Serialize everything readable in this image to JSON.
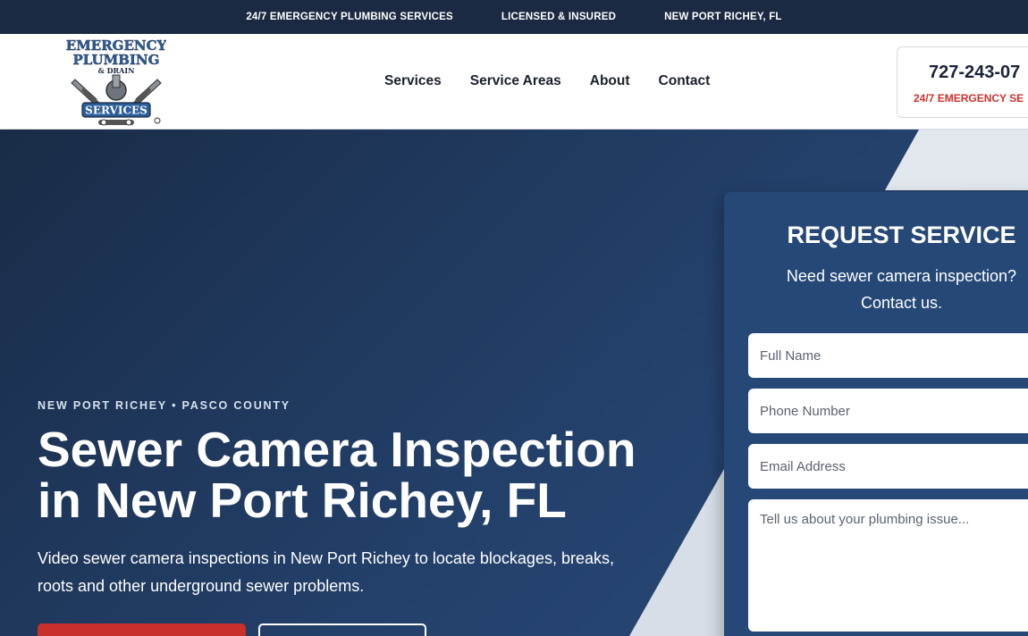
{
  "topbar": {
    "items": [
      "24/7 EMERGENCY PLUMBING SERVICES",
      "LICENSED & INSURED",
      "NEW PORT RICHEY, FL"
    ]
  },
  "header": {
    "logo": {
      "line1": "EMERGENCY",
      "line2": "PLUMBING",
      "line3": "& DRAIN",
      "line4": "SERVICES"
    },
    "nav": [
      "Services",
      "Service Areas",
      "About",
      "Contact"
    ],
    "phone": {
      "number": "727-243-07",
      "subtitle": "24/7 EMERGENCY SE"
    }
  },
  "hero": {
    "eyebrow": "NEW PORT RICHEY • PASCO COUNTY",
    "title_line1": "Sewer Camera Inspection",
    "title_line2": "in New Port Richey, FL",
    "desc_line1": "Video sewer camera inspections in New Port Richey to locate blockages, breaks,",
    "desc_line2": "roots and other underground sewer problems."
  },
  "form": {
    "title": "REQUEST SERVICE",
    "subtitle_line1": "Need sewer camera inspection?",
    "subtitle_line2": "Contact us.",
    "placeholders": {
      "name": "Full Name",
      "phone": "Phone Number",
      "email": "Email Address",
      "message": "Tell us about your plumbing issue..."
    }
  },
  "colors": {
    "topbar": "#1b2942",
    "hero_dark": "#192c47",
    "card": "#254877",
    "accent_red": "#c9302c",
    "logo_blue": "#2a5d9a"
  }
}
